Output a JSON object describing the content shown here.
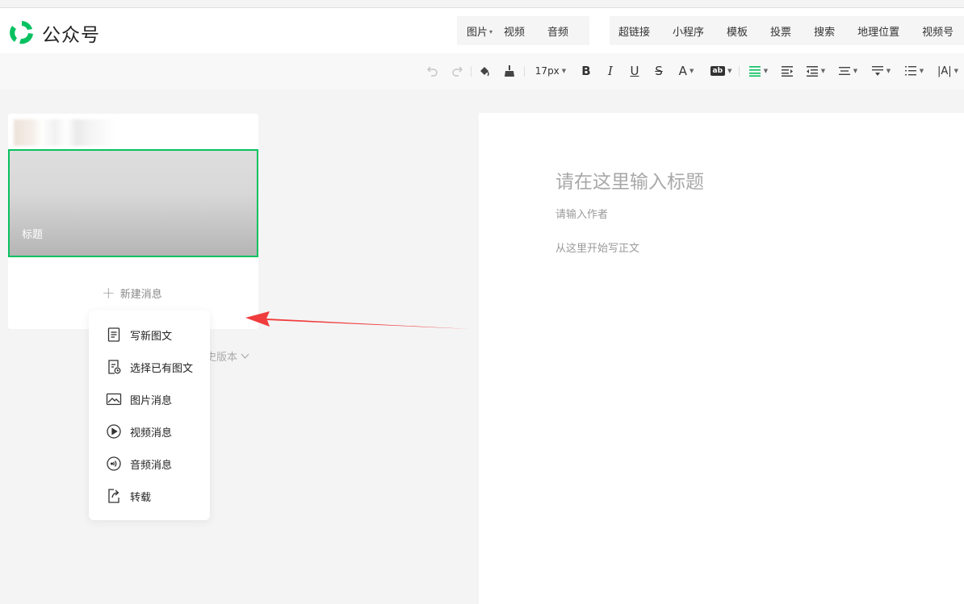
{
  "header": {
    "brand": "公众号",
    "insert_group_1": [
      {
        "label": "图片",
        "dropdown": true
      },
      {
        "label": "视频",
        "dropdown": false
      },
      {
        "label": "音频",
        "dropdown": false
      }
    ],
    "insert_group_2": [
      "超链接",
      "小程序",
      "模板",
      "投票",
      "搜索",
      "地理位置",
      "视频号"
    ]
  },
  "toolbar": {
    "font_size": "17px",
    "bold": "B",
    "italic": "I",
    "underline": "U",
    "strike": "S",
    "font_color": "A",
    "bg_color": "ab",
    "letter_spacing": "|A|",
    "icons": [
      "undo-icon",
      "redo-icon",
      "format-paint-icon",
      "clear-format-icon",
      "align-justify-icon",
      "indent-icon",
      "outdent-icon",
      "line-height-icon",
      "paragraph-spacing-icon",
      "list-icon"
    ],
    "accent": "#07c160"
  },
  "left_panel": {
    "cover_title": "标题",
    "new_message": "新建消息",
    "history": "史版本"
  },
  "new_menu": {
    "items": [
      {
        "label": "写新图文",
        "icon": "document-icon"
      },
      {
        "label": "选择已有图文",
        "icon": "existing-document-icon"
      },
      {
        "label": "图片消息",
        "icon": "image-icon"
      },
      {
        "label": "视频消息",
        "icon": "video-play-icon"
      },
      {
        "label": "音频消息",
        "icon": "audio-icon"
      },
      {
        "label": "转载",
        "icon": "repost-icon"
      }
    ]
  },
  "editor": {
    "title_placeholder": "请在这里输入标题",
    "author_placeholder": "请输入作者",
    "body_placeholder": "从这里开始写正文"
  },
  "colors": {
    "brand_green": "#07c160",
    "annotation_red": "#f03c3c"
  }
}
